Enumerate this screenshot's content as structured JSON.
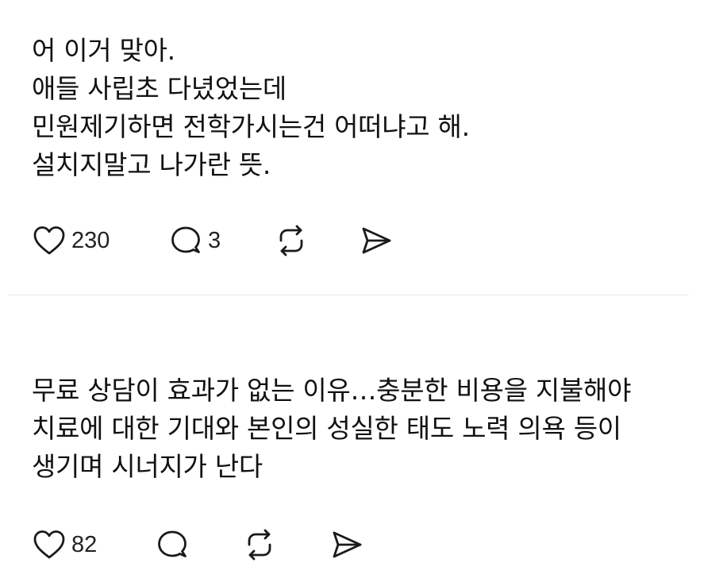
{
  "posts": [
    {
      "lines": [
        "어 이거 맞아.",
        "애들 사립초 다녔었는데",
        "민원제기하면 전학가시는건 어떠냐고 해.",
        "설치지말고 나가란 뜻."
      ],
      "like_count": "230",
      "reply_count": "3"
    },
    {
      "lines": [
        "무료 상담이 효과가 없는 이유…충분한 비용을 지불해야",
        "치료에 대한 기대와 본인의 성실한 태도 노력 의욕 등이",
        "생기며 시너지가 난다"
      ],
      "like_count": "82"
    }
  ],
  "icons": {
    "like": "heart-outline-icon",
    "reply": "speech-bubble-icon",
    "repost": "repost-arrows-icon",
    "share": "send-paper-plane-icon"
  }
}
